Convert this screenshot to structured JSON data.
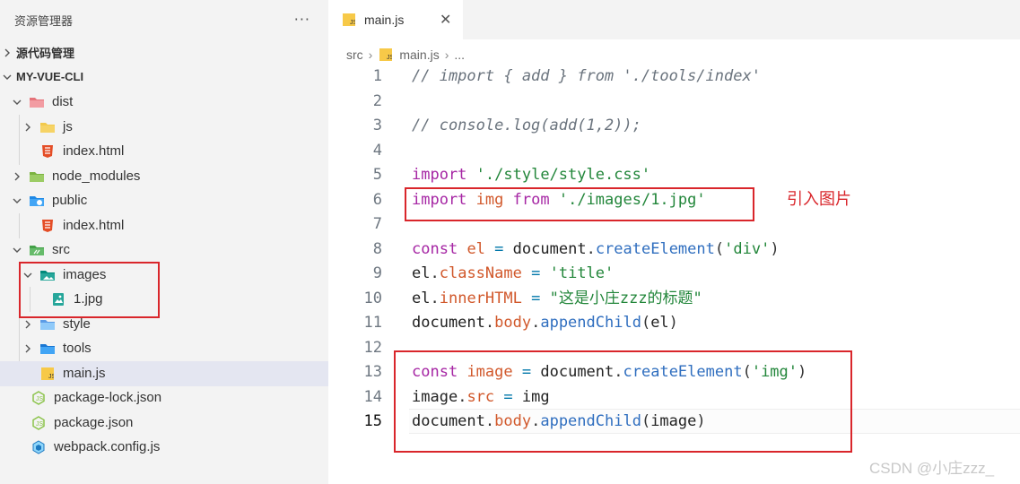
{
  "explorer": {
    "title": "资源管理器",
    "more": "···",
    "source_control": "源代码管理",
    "project": "MY-VUE-CLI",
    "tree": [
      {
        "label": "dist",
        "icon": "dist-folder-icon"
      },
      {
        "label": "js",
        "icon": "js-folder-icon"
      },
      {
        "label": "index.html",
        "icon": "html-file-icon"
      },
      {
        "label": "node_modules",
        "icon": "node-folder-icon"
      },
      {
        "label": "public",
        "icon": "public-folder-icon"
      },
      {
        "label": "index.html",
        "icon": "html-file-icon"
      },
      {
        "label": "src",
        "icon": "src-folder-icon"
      },
      {
        "label": "images",
        "icon": "images-folder-icon"
      },
      {
        "label": "1.jpg",
        "icon": "image-file-icon"
      },
      {
        "label": "style",
        "icon": "style-folder-icon"
      },
      {
        "label": "tools",
        "icon": "tools-folder-icon"
      },
      {
        "label": "main.js",
        "icon": "js-file-icon"
      },
      {
        "label": "package-lock.json",
        "icon": "json-file-icon"
      },
      {
        "label": "package.json",
        "icon": "json-file-icon"
      },
      {
        "label": "webpack.config.js",
        "icon": "webpack-file-icon"
      }
    ]
  },
  "editor": {
    "tab": {
      "label": "main.js",
      "close": "✕"
    },
    "breadcrumb": {
      "folder": "src",
      "file": "main.js",
      "sep": "›",
      "more": "..."
    },
    "line_numbers": [
      "1",
      "2",
      "3",
      "4",
      "5",
      "6",
      "7",
      "8",
      "9",
      "10",
      "11",
      "12",
      "13",
      "14",
      "15"
    ],
    "lines": [
      [
        {
          "t": "cmt",
          "v": "// import { add } from './tools/index'"
        }
      ],
      [],
      [
        {
          "t": "cmt",
          "v": "// console.log(add(1,2));"
        }
      ],
      [],
      [
        {
          "t": "kw",
          "v": "import"
        },
        {
          "t": "pun",
          "v": " "
        },
        {
          "t": "str",
          "v": "'./style/style.css'"
        }
      ],
      [
        {
          "t": "kw",
          "v": "import"
        },
        {
          "t": "pun",
          "v": " "
        },
        {
          "t": "prop",
          "v": "img"
        },
        {
          "t": "pun",
          "v": " "
        },
        {
          "t": "kw",
          "v": "from"
        },
        {
          "t": "pun",
          "v": " "
        },
        {
          "t": "str",
          "v": "'./images/1.jpg'"
        }
      ],
      [],
      [
        {
          "t": "kw",
          "v": "const"
        },
        {
          "t": "pun",
          "v": " "
        },
        {
          "t": "prop",
          "v": "el"
        },
        {
          "t": "pun",
          "v": " "
        },
        {
          "t": "op",
          "v": "="
        },
        {
          "t": "pun",
          "v": " "
        },
        {
          "t": "var",
          "v": "document"
        },
        {
          "t": "pun",
          "v": "."
        },
        {
          "t": "fn",
          "v": "createElement"
        },
        {
          "t": "pun",
          "v": "("
        },
        {
          "t": "str",
          "v": "'div'"
        },
        {
          "t": "pun",
          "v": ")"
        }
      ],
      [
        {
          "t": "var",
          "v": "el"
        },
        {
          "t": "pun",
          "v": "."
        },
        {
          "t": "prop",
          "v": "className"
        },
        {
          "t": "pun",
          "v": " "
        },
        {
          "t": "op",
          "v": "="
        },
        {
          "t": "pun",
          "v": " "
        },
        {
          "t": "str",
          "v": "'title'"
        }
      ],
      [
        {
          "t": "var",
          "v": "el"
        },
        {
          "t": "pun",
          "v": "."
        },
        {
          "t": "prop",
          "v": "innerHTML"
        },
        {
          "t": "pun",
          "v": " "
        },
        {
          "t": "op",
          "v": "="
        },
        {
          "t": "pun",
          "v": " "
        },
        {
          "t": "str",
          "v": "\"这是小庄zzz的标题\""
        }
      ],
      [
        {
          "t": "var",
          "v": "document"
        },
        {
          "t": "pun",
          "v": "."
        },
        {
          "t": "prop",
          "v": "body"
        },
        {
          "t": "pun",
          "v": "."
        },
        {
          "t": "fn",
          "v": "appendChild"
        },
        {
          "t": "pun",
          "v": "("
        },
        {
          "t": "var",
          "v": "el"
        },
        {
          "t": "pun",
          "v": ")"
        }
      ],
      [],
      [
        {
          "t": "kw",
          "v": "const"
        },
        {
          "t": "pun",
          "v": " "
        },
        {
          "t": "prop",
          "v": "image"
        },
        {
          "t": "pun",
          "v": " "
        },
        {
          "t": "op",
          "v": "="
        },
        {
          "t": "pun",
          "v": " "
        },
        {
          "t": "var",
          "v": "document"
        },
        {
          "t": "pun",
          "v": "."
        },
        {
          "t": "fn",
          "v": "createElement"
        },
        {
          "t": "pun",
          "v": "("
        },
        {
          "t": "str",
          "v": "'img'"
        },
        {
          "t": "pun",
          "v": ")"
        }
      ],
      [
        {
          "t": "var",
          "v": "image"
        },
        {
          "t": "pun",
          "v": "."
        },
        {
          "t": "prop",
          "v": "src"
        },
        {
          "t": "pun",
          "v": " "
        },
        {
          "t": "op",
          "v": "="
        },
        {
          "t": "pun",
          "v": " "
        },
        {
          "t": "var",
          "v": "img"
        }
      ],
      [
        {
          "t": "var",
          "v": "document"
        },
        {
          "t": "pun",
          "v": "."
        },
        {
          "t": "prop",
          "v": "body"
        },
        {
          "t": "pun",
          "v": "."
        },
        {
          "t": "fn",
          "v": "appendChild"
        },
        {
          "t": "pun",
          "v": "("
        },
        {
          "t": "var",
          "v": "image"
        },
        {
          "t": "pun",
          "v": ")"
        }
      ]
    ],
    "current_line": "15"
  },
  "annotation": "引入图片",
  "watermark": "CSDN @小庄zzz_",
  "colors": {
    "annotation_red": "#d9262b",
    "selected_row": "#e4e6f1",
    "sidebar_bg": "#f3f3f3"
  }
}
